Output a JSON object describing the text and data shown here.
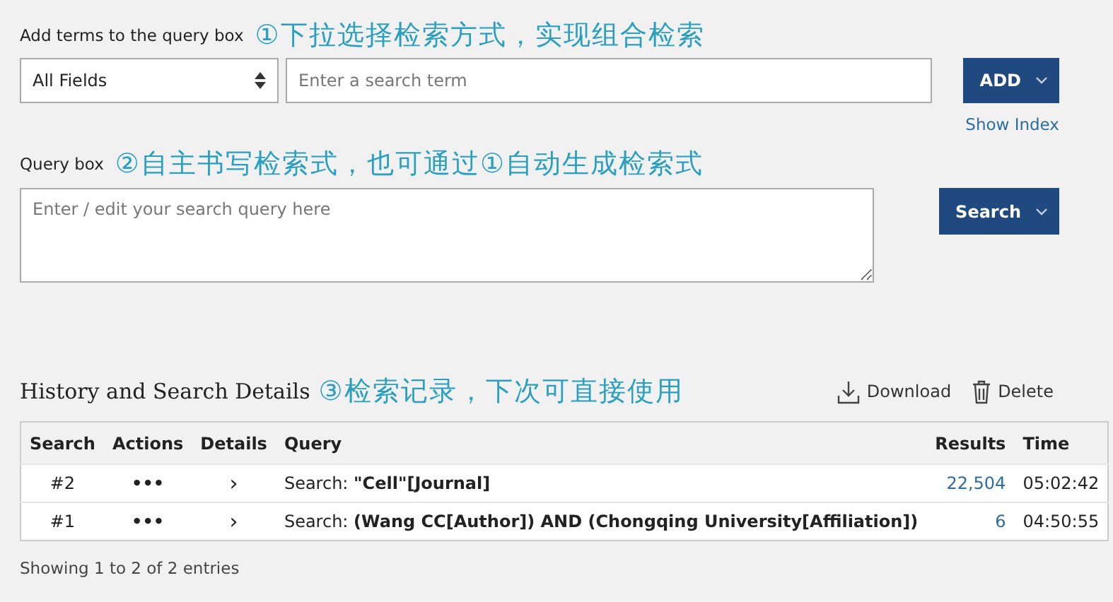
{
  "add_terms": {
    "label": "Add terms to the query box",
    "annotation": "①下拉选择检索方式，实现组合检索",
    "field_select": {
      "value": "All Fields"
    },
    "term_input": {
      "placeholder": "Enter a search term"
    },
    "add_button": "ADD",
    "show_index": "Show Index"
  },
  "query_box": {
    "label": "Query box",
    "annotation": "②自主书写检索式，也可通过①自动生成检索式",
    "placeholder": "Enter / edit your search query here",
    "search_button": "Search"
  },
  "history": {
    "title": "History and Search Details",
    "annotation": "③检索记录，下次可直接使用",
    "actions": [
      {
        "kind": "download",
        "label": "Download"
      },
      {
        "kind": "delete",
        "label": "Delete"
      }
    ],
    "table": {
      "columns": [
        "Search",
        "Actions",
        "Details",
        "Query",
        "Results",
        "Time"
      ],
      "rows": [
        {
          "search": "#2",
          "actions": "•••",
          "details": "›",
          "query": "Search: **\"Cell\"[Journal]**",
          "results": "22,504",
          "time": "05:02:42"
        },
        {
          "search": "#1",
          "actions": "•••",
          "details": "›",
          "query": "Search: **(Wang CC[Author]) AND (Chongqing University[Affiliation])**",
          "results": "6",
          "time": "04:50:55"
        }
      ]
    },
    "footer": "Showing 1 to 2 of 2 entries"
  }
}
